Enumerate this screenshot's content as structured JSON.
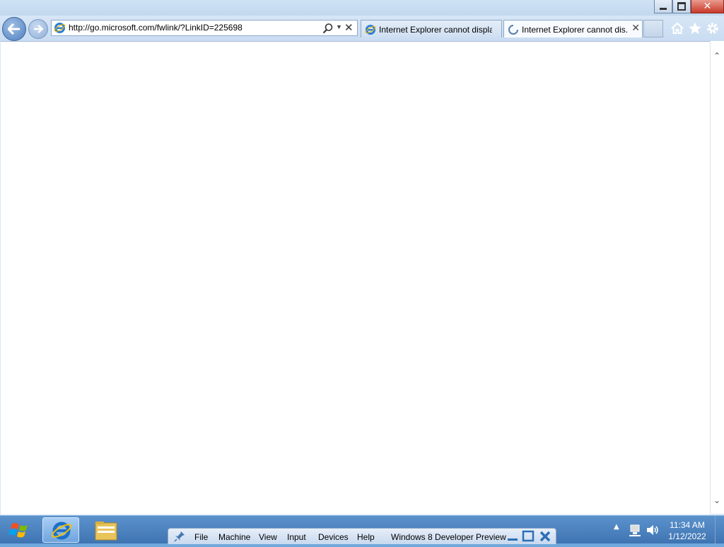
{
  "browser": {
    "address": {
      "url": "http://go.microsoft.com/fwlink/?LinkID=225698"
    },
    "tabs": [
      {
        "label": "Internet Explorer cannot displa...",
        "state": "idle"
      },
      {
        "label": "Internet Explorer cannot dis...",
        "state": "loading",
        "active": true
      }
    ],
    "caption": {
      "minimize": "",
      "maximize": "",
      "close": "✕"
    }
  },
  "vm_bar": {
    "menus": [
      "File",
      "Machine",
      "View",
      "Input",
      "Devices",
      "Help"
    ],
    "title": "Windows 8 Developer Preview"
  },
  "clock": {
    "time": "11:34 AM",
    "date": "1/12/2022"
  },
  "icons": [
    "back-icon",
    "forward-icon",
    "ie-icon",
    "search-icon",
    "dropdown-icon",
    "stop-icon",
    "loading-icon",
    "close-icon",
    "home-icon",
    "favorites-icon",
    "tools-icon",
    "windows-logo-icon",
    "folder-icon",
    "pin-icon",
    "network-icon",
    "volume-icon"
  ],
  "colors": {
    "taskbar": "#4a82c0",
    "frame": "#c9dcf1",
    "close": "#c8392a"
  }
}
